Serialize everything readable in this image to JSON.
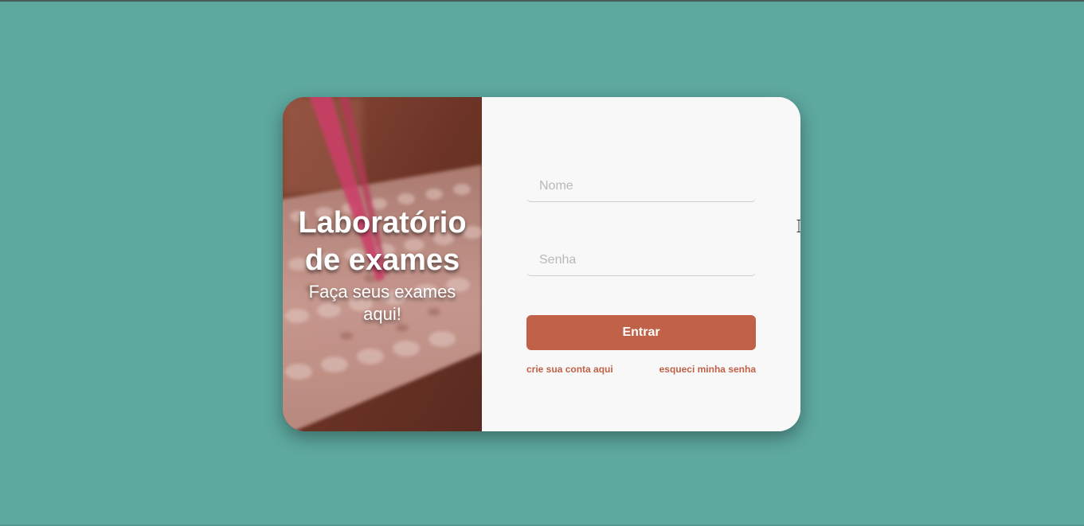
{
  "hero": {
    "title_line1": "Laboratório",
    "title_line2": "de exames",
    "subtitle_line1": "Faça seus exames",
    "subtitle_line2": "aqui!"
  },
  "form": {
    "name_placeholder": "Nome",
    "password_placeholder": "Senha",
    "submit_label": "Entrar",
    "create_account_label": "crie sua conta aqui",
    "forgot_password_label": "esqueci minha senha"
  },
  "colors": {
    "background": "#5da89f",
    "card": "#f8f8f8",
    "accent": "#c06148"
  },
  "icons": {
    "cursor": "text-cursor-icon"
  }
}
